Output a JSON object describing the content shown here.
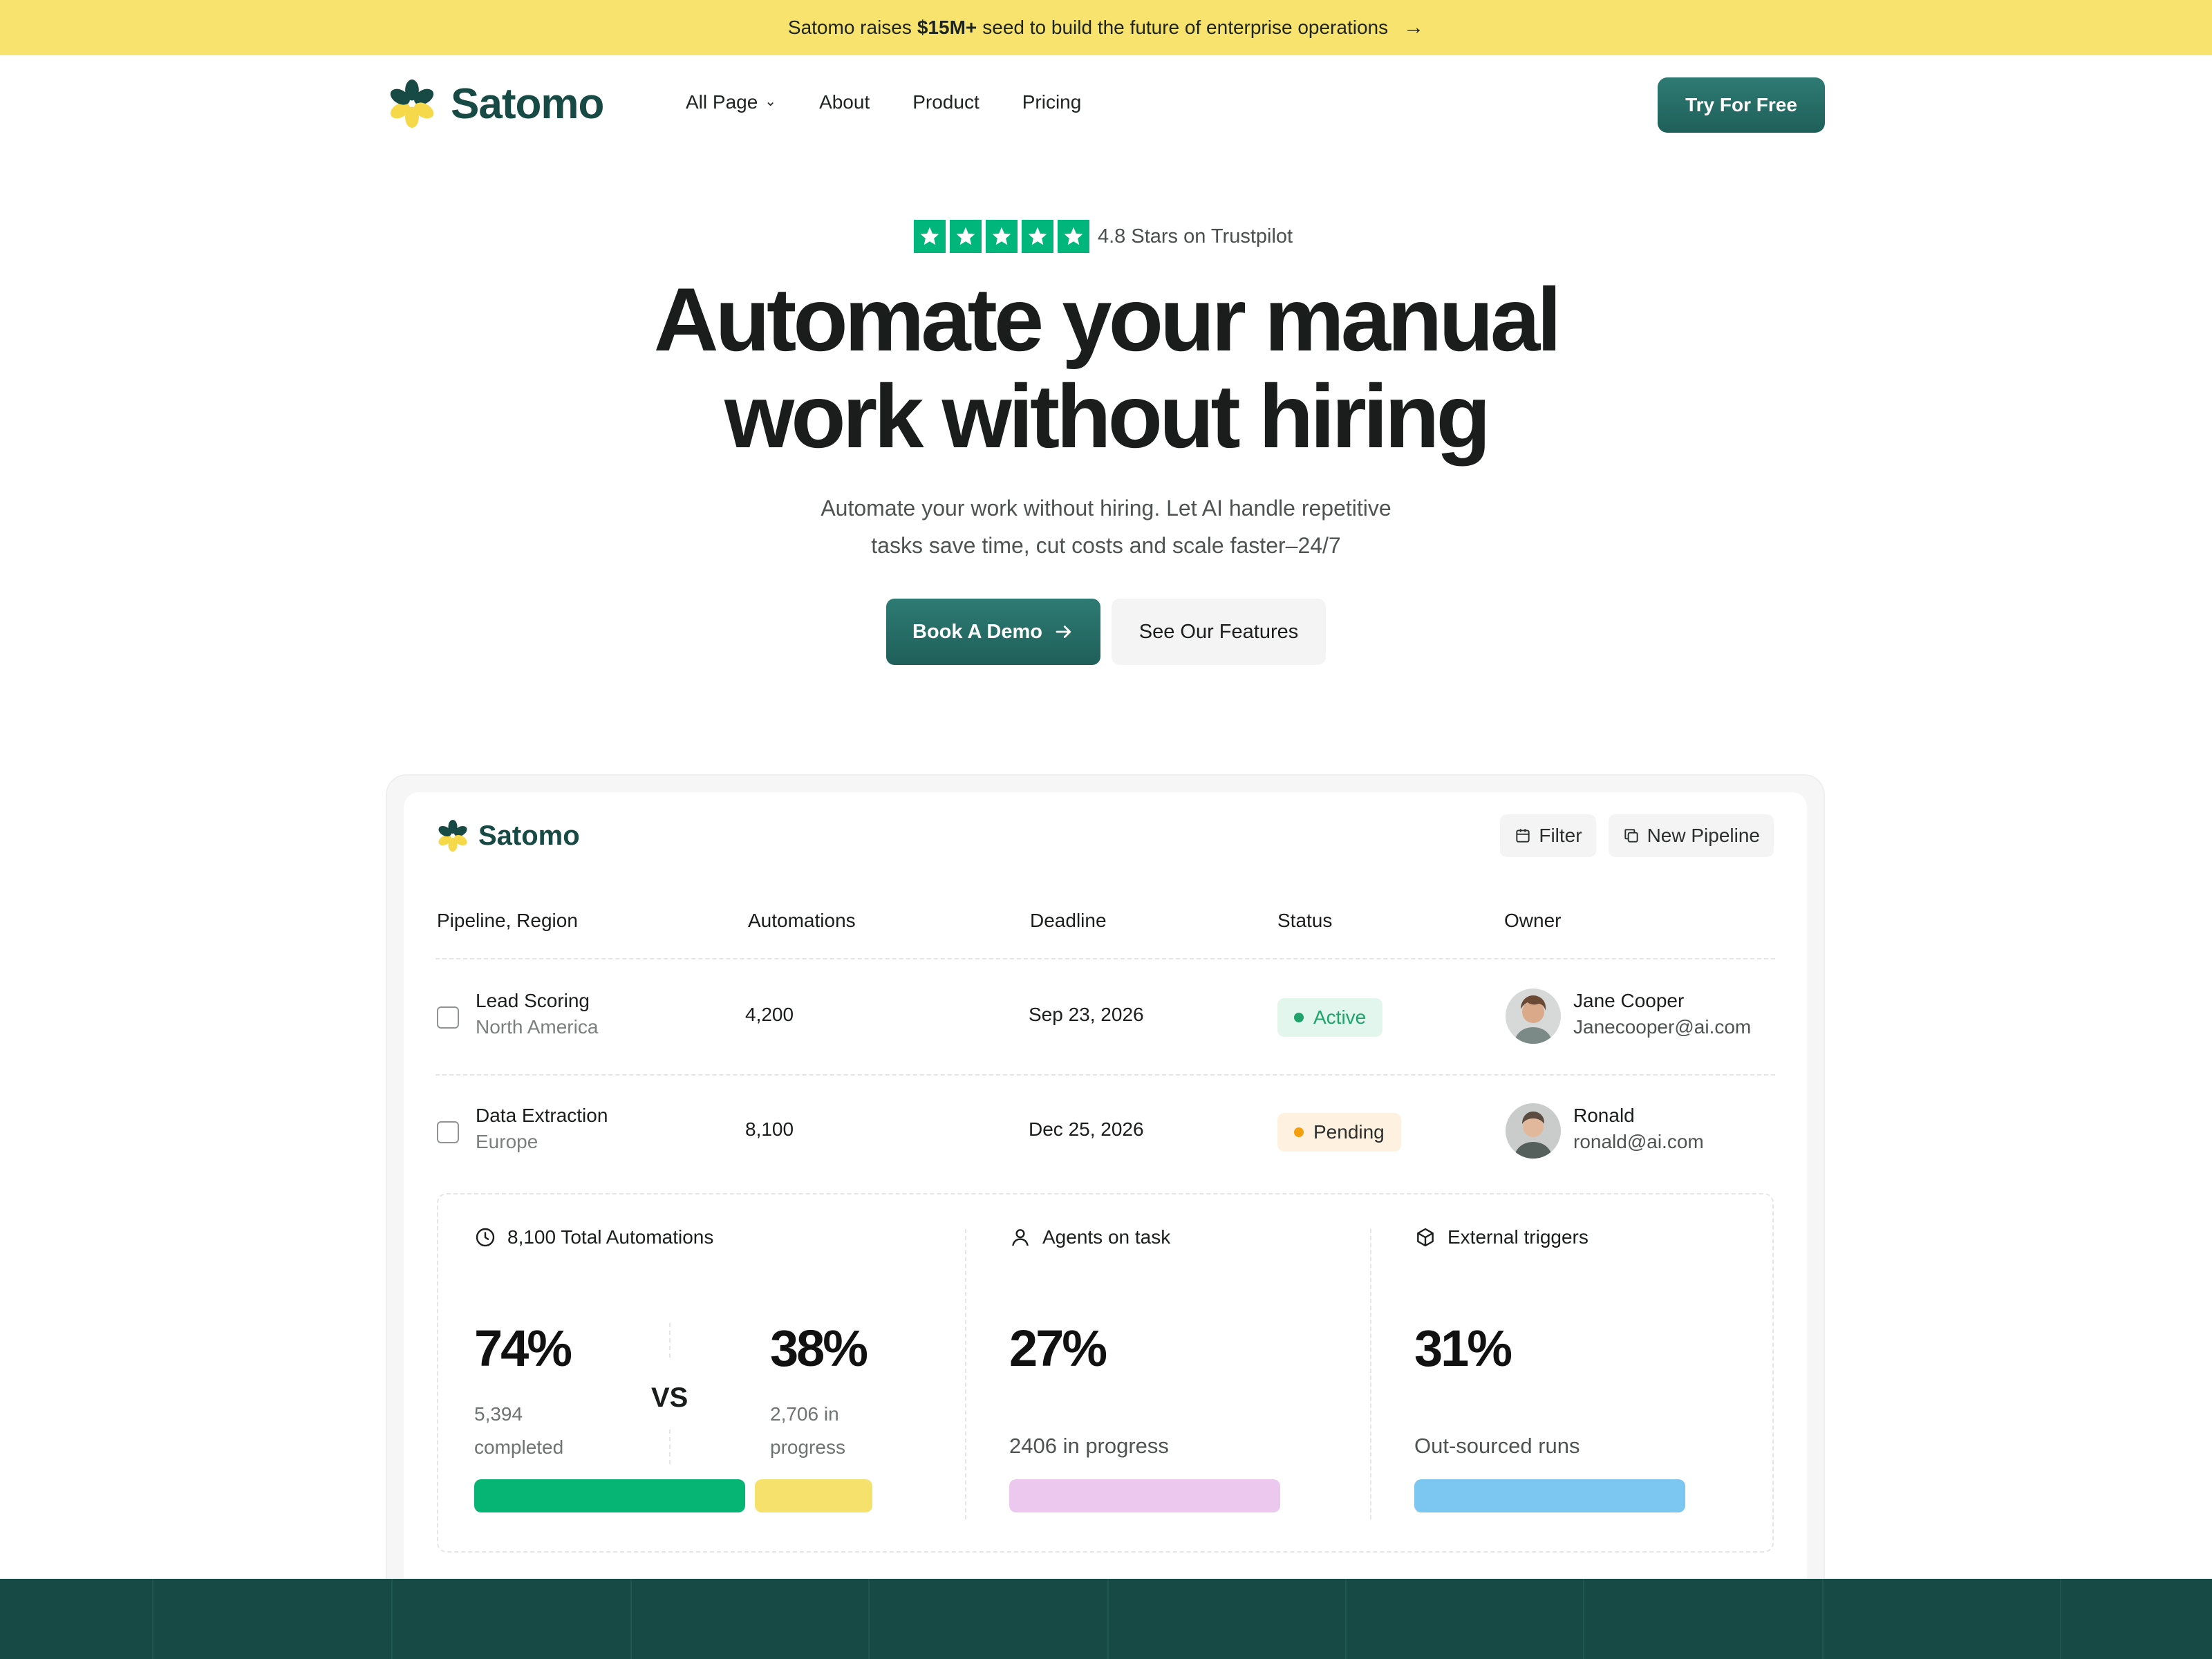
{
  "announcement": {
    "prefix": "Satomo raises ",
    "amount": "$15M+",
    "suffix": " seed to build the future of enterprise operations",
    "arrow": "→"
  },
  "nav": {
    "logo_text": "Satomo",
    "links": [
      {
        "label": "All Page",
        "has_dropdown": true
      },
      {
        "label": "About"
      },
      {
        "label": "Product"
      },
      {
        "label": "Pricing"
      }
    ],
    "cta": "Try For Free"
  },
  "hero": {
    "rating_text": "4.8 Stars on Trustpilot",
    "star_count": 5,
    "title_line1": "Automate your manual",
    "title_line2": "work without hiring",
    "subtitle_line1": "Automate your work without hiring. Let AI handle repetitive",
    "subtitle_line2": "tasks save time, cut costs and scale faster–24/7",
    "primary_cta": "Book A Demo",
    "secondary_cta": "See Our Features"
  },
  "dashboard": {
    "logo_text": "Satomo",
    "filter_label": "Filter",
    "new_pipeline_label": "New Pipeline",
    "columns": [
      "Pipeline, Region",
      "Automations",
      "Deadline",
      "Status",
      "Owner"
    ],
    "rows": [
      {
        "pipeline": "Lead Scoring",
        "region": "North America",
        "automations": "4,200",
        "deadline": "Sep 23, 2026",
        "status": "Active",
        "owner_name": "Jane Cooper",
        "owner_email": "Janecooper@ai.com"
      },
      {
        "pipeline": "Data Extraction",
        "region": "Europe",
        "automations": "8,100",
        "deadline": "Dec 25, 2026",
        "status": "Pending",
        "owner_name": "Ronald",
        "owner_email": "ronald@ai.com"
      }
    ],
    "stats": {
      "total_label": "8,100 Total Automations",
      "completed_pct": "74%",
      "completed_count": "5,394",
      "completed_label": "completed",
      "vs": "VS",
      "progress_pct": "38%",
      "progress_count": "2,706 in",
      "progress_label": "progress",
      "agents_label": "Agents on  task",
      "agents_pct": "27%",
      "agents_sub": "2406 in progress",
      "external_label": "External triggers",
      "external_pct": "31%",
      "external_sub": "Out-sourced runs"
    }
  },
  "colors": {
    "brand": "#174a44",
    "accent": "#f8e36e",
    "cta": "#2e7b74",
    "trustpilot": "#00b67a",
    "active_bg": "#e3f6ee",
    "active": "#1fa36b",
    "pending_bg": "#fff1e0",
    "pending": "#f59e0b",
    "bar_completed": "#06b474",
    "bar_progress": "#f7e16d",
    "bar_agents": "#ecc8ef",
    "bar_external": "#7cc6f2"
  }
}
